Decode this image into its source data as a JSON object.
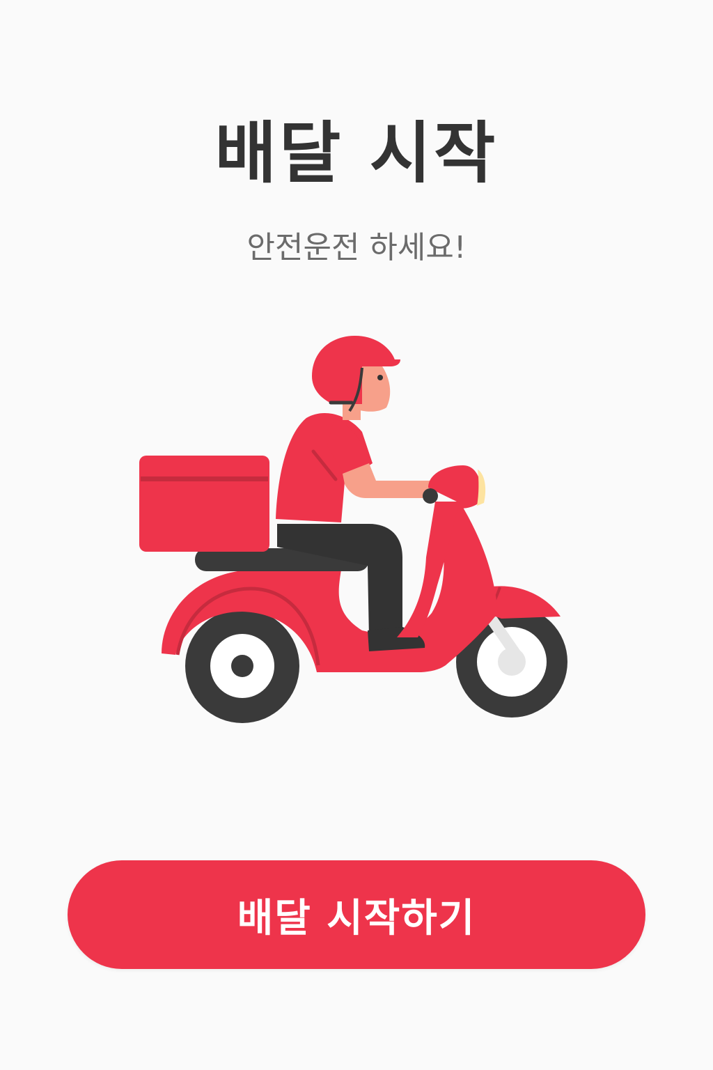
{
  "header": {
    "title": "배달 시작",
    "subtitle": "안전운전 하세요!"
  },
  "illustration": {
    "icon": "delivery-scooter-rider-icon"
  },
  "actions": {
    "start_label": "배달 시작하기"
  },
  "colors": {
    "accent": "#ee344b",
    "title_text": "#333333",
    "subtitle_text": "#6b6b6b",
    "background": "#fafafa"
  }
}
